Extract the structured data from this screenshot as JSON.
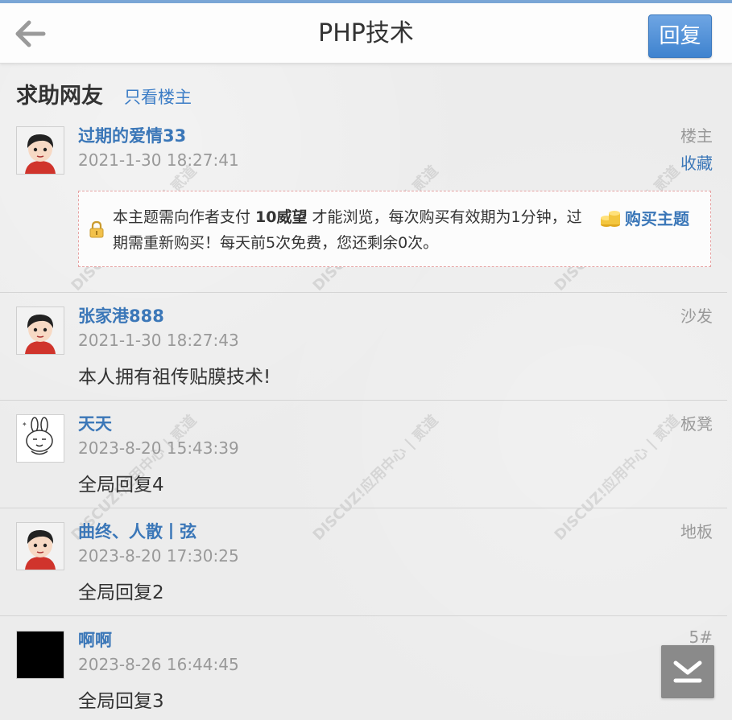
{
  "header": {
    "title": "PHP技术",
    "reply_label": "回复"
  },
  "thread": {
    "title": "求助网友",
    "only_op_label": "只看楼主"
  },
  "posts": [
    {
      "author": "过期的爱情33",
      "time": "2021-1-30 18:27:41",
      "floor": "楼主",
      "favorite_label": "收藏",
      "locked": {
        "text_before": "本主题需向作者支付 ",
        "price": "10威望",
        "text_after": " 才能浏览，每次购买有效期为1分钟，过期需重新购买！每天前5次免费，您还剩余0次。",
        "buy_label": "购买主题"
      },
      "avatar": "cartoon-boy-avatar"
    },
    {
      "author": "张家港888",
      "time": "2021-1-30 18:27:43",
      "floor": "沙发",
      "content": "本人拥有祖传贴膜技术!",
      "avatar": "cartoon-boy-avatar"
    },
    {
      "author": "天天",
      "time": "2023-8-20 15:43:39",
      "floor": "板凳",
      "content": "全局回复4",
      "avatar": "rabbit-avatar"
    },
    {
      "author": "曲终、人散丨弦",
      "time": "2023-8-20 17:30:25",
      "floor": "地板",
      "content": "全局回复2",
      "avatar": "cartoon-boy-avatar"
    },
    {
      "author": "啊啊",
      "time": "2023-8-26 16:44:45",
      "floor": "5#",
      "content": "全局回复3",
      "avatar": "black-avatar"
    }
  ],
  "watermark_text": "DISCUZ!应用中心 | 贰道 addon.dismall.com",
  "colors": {
    "link": "#3b77b8",
    "reply_button": "#4a8bd4",
    "meta_gray": "#999999",
    "lock_border": "#e6a3a3"
  }
}
